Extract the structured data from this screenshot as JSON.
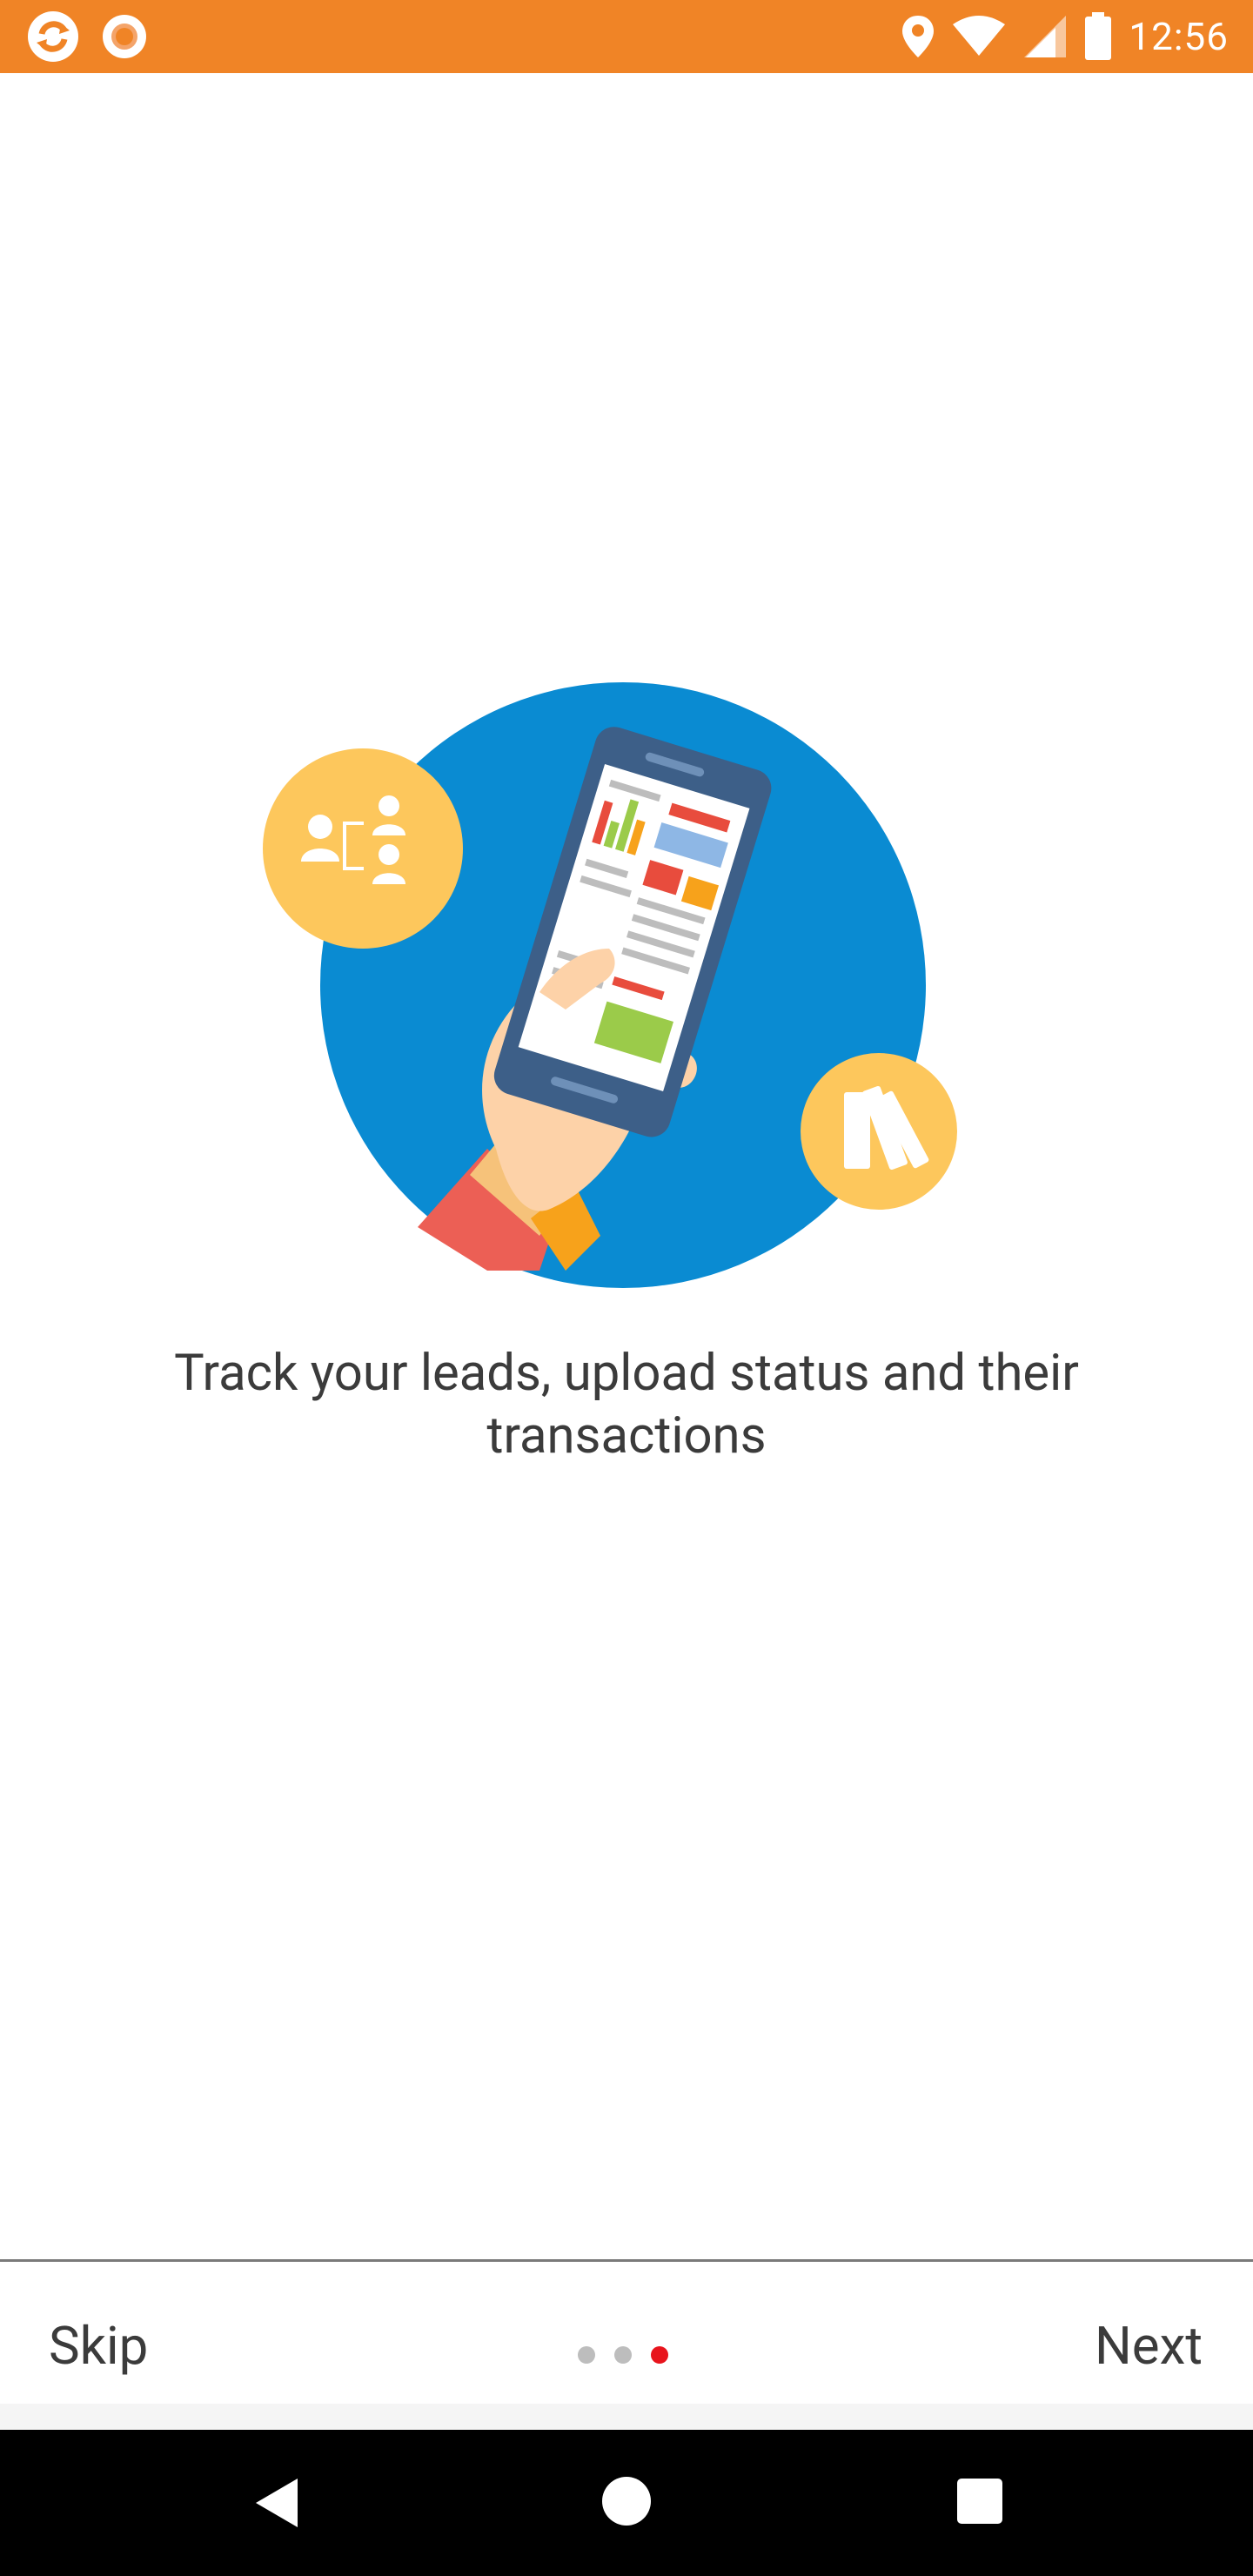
{
  "status_bar": {
    "time": "12:56",
    "color": "#F08426",
    "icons_left": [
      "app-refresh-icon",
      "app-record-icon"
    ],
    "icons_right": [
      "location-icon",
      "wifi-icon",
      "signal-icon",
      "battery-icon"
    ]
  },
  "onboarding": {
    "caption": "Track your leads, upload status and their transactions",
    "illustration": "hand-holding-phone-with-report"
  },
  "footer": {
    "skip_label": "Skip",
    "next_label": "Next",
    "pager": {
      "total": 3,
      "active_index": 2,
      "active_color": "#E8141C",
      "inactive_color": "#BDBDBD"
    }
  },
  "nav_bar": {
    "icons": [
      "back-icon",
      "home-icon",
      "recent-apps-icon"
    ]
  }
}
